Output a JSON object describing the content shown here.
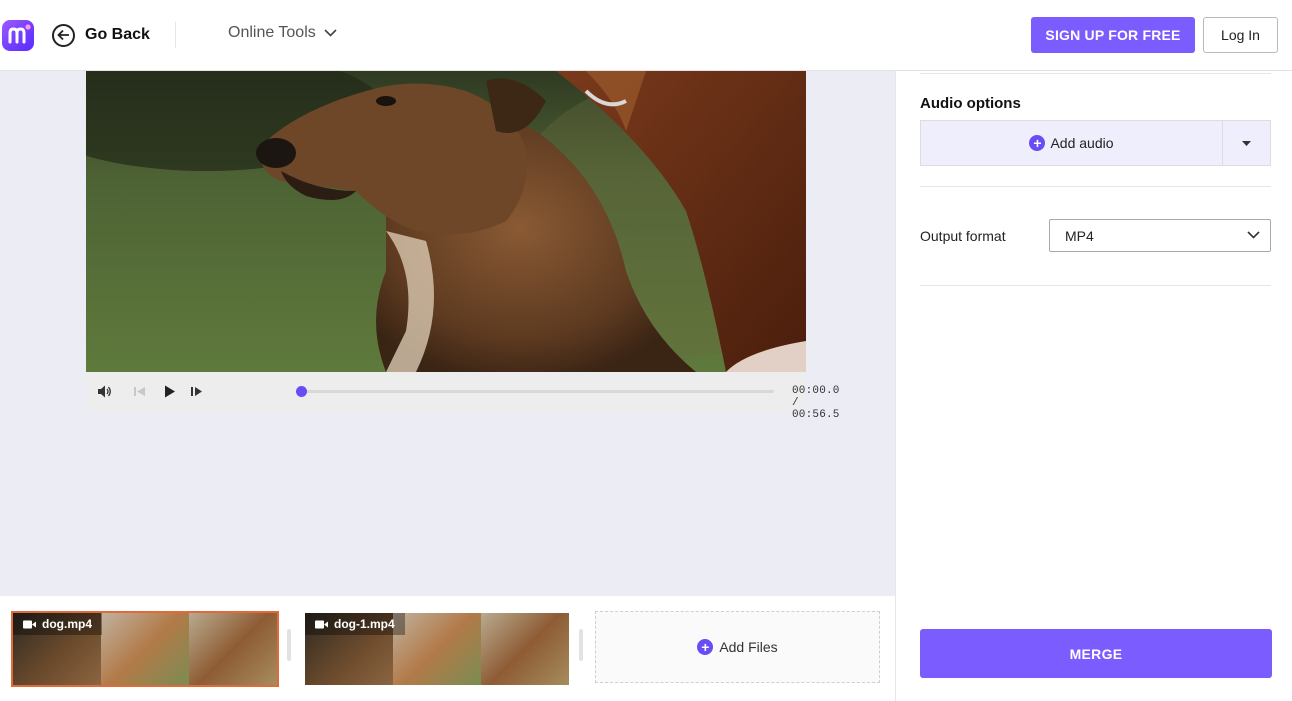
{
  "header": {
    "back_label": "Go Back",
    "online_tools_label": "Online Tools",
    "signup_label": "SIGN UP FOR FREE",
    "login_label": "Log In",
    "brand_color": "#7b5cff"
  },
  "player": {
    "current_time": "00:00.0",
    "separator": "/",
    "total_time": "00:56.5",
    "progress": 0
  },
  "clips": [
    {
      "name": "dog.mp4",
      "selected": true
    },
    {
      "name": "dog-1.mp4",
      "selected": false
    }
  ],
  "add_files_label": "Add Files",
  "panel": {
    "audio_title": "Audio options",
    "add_audio_label": "Add audio",
    "output_label": "Output format",
    "output_value": "MP4",
    "merge_label": "MERGE"
  },
  "icons": [
    "logo-icon",
    "back-arrow-icon",
    "chevron-down-icon",
    "volume-icon",
    "skip-back-icon",
    "play-icon",
    "skip-forward-icon",
    "video-camera-icon",
    "plus-circle-icon",
    "caret-down-icon"
  ]
}
